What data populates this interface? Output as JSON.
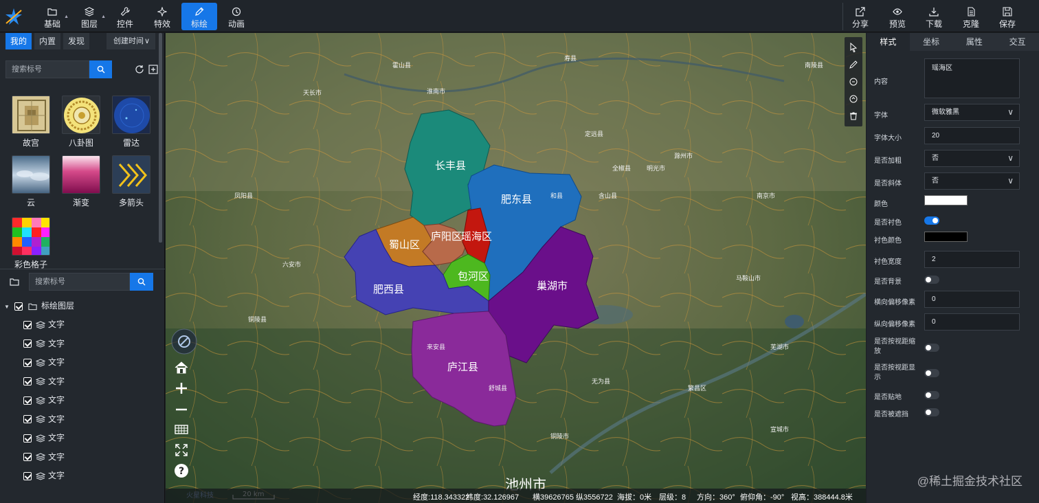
{
  "topbar": {
    "tools": [
      {
        "label": "基础",
        "icon": "folder-icon",
        "has_menu": true
      },
      {
        "label": "图层",
        "icon": "layers-icon",
        "has_menu": true
      },
      {
        "label": "控件",
        "icon": "wrench-icon",
        "has_menu": false
      },
      {
        "label": "特效",
        "icon": "sparkle-icon",
        "has_menu": false
      },
      {
        "label": "标绘",
        "icon": "pencil-icon",
        "has_menu": false,
        "active": true
      },
      {
        "label": "动画",
        "icon": "clock-icon",
        "has_menu": false
      }
    ],
    "actions": [
      {
        "label": "分享",
        "icon": "share-icon"
      },
      {
        "label": "预览",
        "icon": "eye-icon"
      },
      {
        "label": "下载",
        "icon": "download-icon"
      },
      {
        "label": "克隆",
        "icon": "clone-icon"
      },
      {
        "label": "保存",
        "icon": "save-icon"
      }
    ]
  },
  "left": {
    "tabs": [
      "我的",
      "内置",
      "发现"
    ],
    "active_tab": "我的",
    "sort": "创建时间",
    "search_placeholder": "搜索标号",
    "symbols": [
      {
        "label": "故宫",
        "icon": "palace-thumb"
      },
      {
        "label": "八卦图",
        "icon": "bagua-thumb"
      },
      {
        "label": "雷达",
        "icon": "radar-thumb"
      },
      {
        "label": "云",
        "icon": "cloud-thumb"
      },
      {
        "label": "渐变",
        "icon": "gradient-thumb"
      },
      {
        "label": "多箭头",
        "icon": "multi-arrow-thumb"
      },
      {
        "label": "彩色格子",
        "icon": "color-grid-thumb"
      }
    ],
    "tree_search_placeholder": "搜索标号",
    "tree_root": "标绘图层",
    "tree_items": [
      "文字",
      "文字",
      "文字",
      "文字",
      "文字",
      "文字",
      "文字",
      "文字",
      "文字"
    ]
  },
  "map": {
    "regions": [
      {
        "name": "长丰县",
        "color": "#1b8a7a"
      },
      {
        "name": "肥东县",
        "color": "#1f6fbd"
      },
      {
        "name": "蜀山区",
        "color": "#c37a25"
      },
      {
        "name": "庐阳区",
        "color": "#b86a4a"
      },
      {
        "name": "瑶海区",
        "color": "#c3170f"
      },
      {
        "name": "包河区",
        "color": "#4db81f"
      },
      {
        "name": "肥西县",
        "color": "#4542b3"
      },
      {
        "name": "巢湖市",
        "color": "#6a0f8a"
      },
      {
        "name": "庐江县",
        "color": "#8a2a9a"
      }
    ],
    "region_label_text": "庐阳区",
    "region_label_text2": "瑶海区",
    "city_label": "池州市",
    "small_labels": [
      "淮南市",
      "滁州市",
      "南京市",
      "马鞍山市",
      "芜湖市",
      "六安市",
      "铜陵市",
      "宣城市",
      "和县",
      "含山县",
      "全椒县",
      "定远县",
      "明光市",
      "来安县",
      "舒城县",
      "无为县",
      "繁昌区",
      "南陵县",
      "铜陵县",
      "天长市",
      "霍山县",
      "寿县",
      "凤阳县"
    ],
    "scale": "20 km",
    "brand": "火星科技"
  },
  "status": {
    "lng_label": "经度:",
    "lng": "118.343322",
    "lat_label": "纬度:",
    "lat": "32.126967",
    "xy": "横39626765 纵3556722",
    "alt_label": "海拔：",
    "alt": "0米",
    "level_label": "层级：",
    "level": "8",
    "heading_label": "方向：",
    "heading": "360°",
    "pitch_label": "俯仰角：",
    "pitch": "-90°",
    "height_label": "视高：",
    "height": "388444.8米"
  },
  "right": {
    "tabs": [
      "样式",
      "坐标",
      "属性",
      "交互"
    ],
    "active_tab": "样式",
    "fields": {
      "content_label": "内容",
      "content_value": "瑶海区",
      "font_label": "字体",
      "font_value": "微软雅黑",
      "size_label": "字体大小",
      "size_value": "20",
      "bold_label": "是否加粗",
      "bold_value": "否",
      "italic_label": "是否斜体",
      "italic_value": "否",
      "color_label": "颜色",
      "color_value": "#ffffff",
      "outline_label": "是否衬色",
      "outline_on": true,
      "outline_color_label": "衬色颜色",
      "outline_color_value": "#000000",
      "outline_width_label": "衬色宽度",
      "outline_width_value": "2",
      "background_label": "是否背景",
      "background_on": false,
      "offset_x_label": "横向偏移像素",
      "offset_x_value": "0",
      "offset_y_label": "纵向偏移像素",
      "offset_y_value": "0",
      "scale_by_dist_label_1": "是否按视距缩",
      "scale_by_dist_label_2": "放",
      "scale_by_dist_on": false,
      "show_by_dist_label_1": "是否按视距显",
      "show_by_dist_label_2": "示",
      "show_by_dist_on": false,
      "clamp_label": "是否贴地",
      "clamp_on": false,
      "occlusion_label": "是否被遮挡",
      "occlusion_on": false
    }
  },
  "watermark": "@稀土掘金技术社区"
}
